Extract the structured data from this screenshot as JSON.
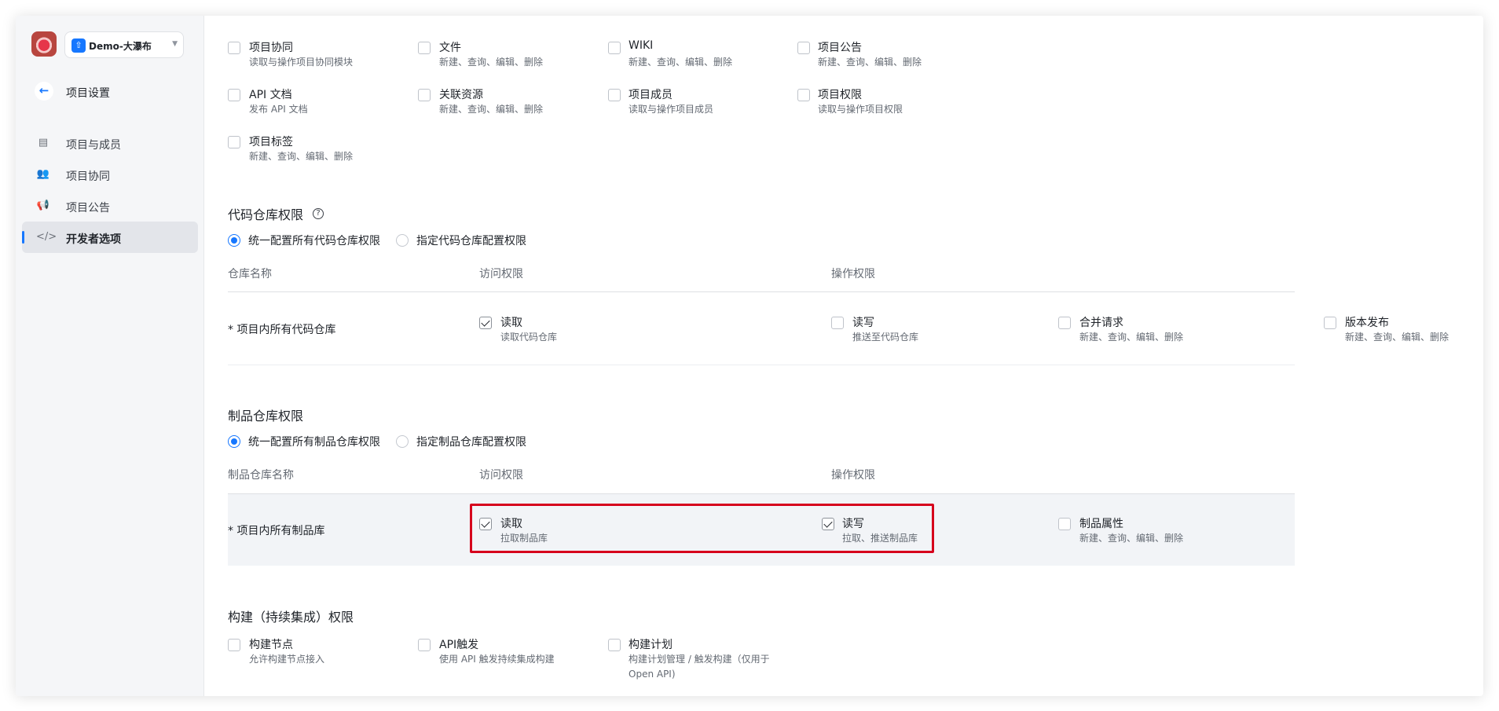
{
  "sidebar": {
    "workspace_name": "Demo-大瀑布",
    "back_label": "项目设置",
    "items": [
      {
        "label": "项目与成员",
        "icon": "project-member-icon"
      },
      {
        "label": "项目协同",
        "icon": "people-icon"
      },
      {
        "label": "项目公告",
        "icon": "megaphone-icon"
      },
      {
        "label": "开发者选项",
        "icon": "code-icon",
        "active": true
      }
    ]
  },
  "project_permissions": [
    {
      "title": "项目协同",
      "desc": "读取与操作项目协同模块",
      "checked": false
    },
    {
      "title": "文件",
      "desc": "新建、查询、编辑、删除",
      "checked": false
    },
    {
      "title": "WIKI",
      "desc": "新建、查询、编辑、删除",
      "checked": false
    },
    {
      "title": "项目公告",
      "desc": "新建、查询、编辑、删除",
      "checked": false
    },
    {
      "title": "API 文档",
      "desc": "发布 API 文档",
      "checked": false
    },
    {
      "title": "关联资源",
      "desc": "新建、查询、编辑、删除",
      "checked": false
    },
    {
      "title": "项目成员",
      "desc": "读取与操作项目成员",
      "checked": false
    },
    {
      "title": "项目权限",
      "desc": "读取与操作项目权限",
      "checked": false
    },
    {
      "title": "项目标签",
      "desc": "新建、查询、编辑、删除",
      "checked": false
    }
  ],
  "code_repo": {
    "title": "代码仓库权限",
    "radio_all": "统一配置所有代码仓库权限",
    "radio_specific": "指定代码仓库配置权限",
    "col_name": "仓库名称",
    "col_access": "访问权限",
    "col_ops": "操作权限",
    "row_name": "* 项目内所有代码仓库",
    "perms": [
      {
        "title": "读取",
        "desc": "读取代码仓库",
        "checked": true
      },
      {
        "title": "读写",
        "desc": "推送至代码仓库",
        "checked": false
      },
      {
        "title": "合并请求",
        "desc": "新建、查询、编辑、删除",
        "checked": false
      },
      {
        "title": "版本发布",
        "desc": "新建、查询、编辑、删除",
        "checked": false
      }
    ]
  },
  "artifact_repo": {
    "title": "制品仓库权限",
    "radio_all": "统一配置所有制品仓库权限",
    "radio_specific": "指定制品仓库配置权限",
    "col_name": "制品仓库名称",
    "col_access": "访问权限",
    "col_ops": "操作权限",
    "row_name": "* 项目内所有制品库",
    "perms": [
      {
        "title": "读取",
        "desc": "拉取制品库",
        "checked": true
      },
      {
        "title": "读写",
        "desc": "拉取、推送制品库",
        "checked": true
      },
      {
        "title": "制品属性",
        "desc": "新建、查询、编辑、删除",
        "checked": false
      }
    ]
  },
  "ci": {
    "title": "构建（持续集成）权限",
    "perms": [
      {
        "title": "构建节点",
        "desc": "允许构建节点接入",
        "checked": false
      },
      {
        "title": "API触发",
        "desc": "使用 API 触发持续集成构建",
        "checked": false
      },
      {
        "title": "构建计划",
        "desc": "构建计划管理 / 触发构建（仅用于",
        "desc2": "Open API)",
        "checked": false
      }
    ]
  },
  "colors": {
    "accent": "#1677ff",
    "highlight": "#d6001c"
  }
}
